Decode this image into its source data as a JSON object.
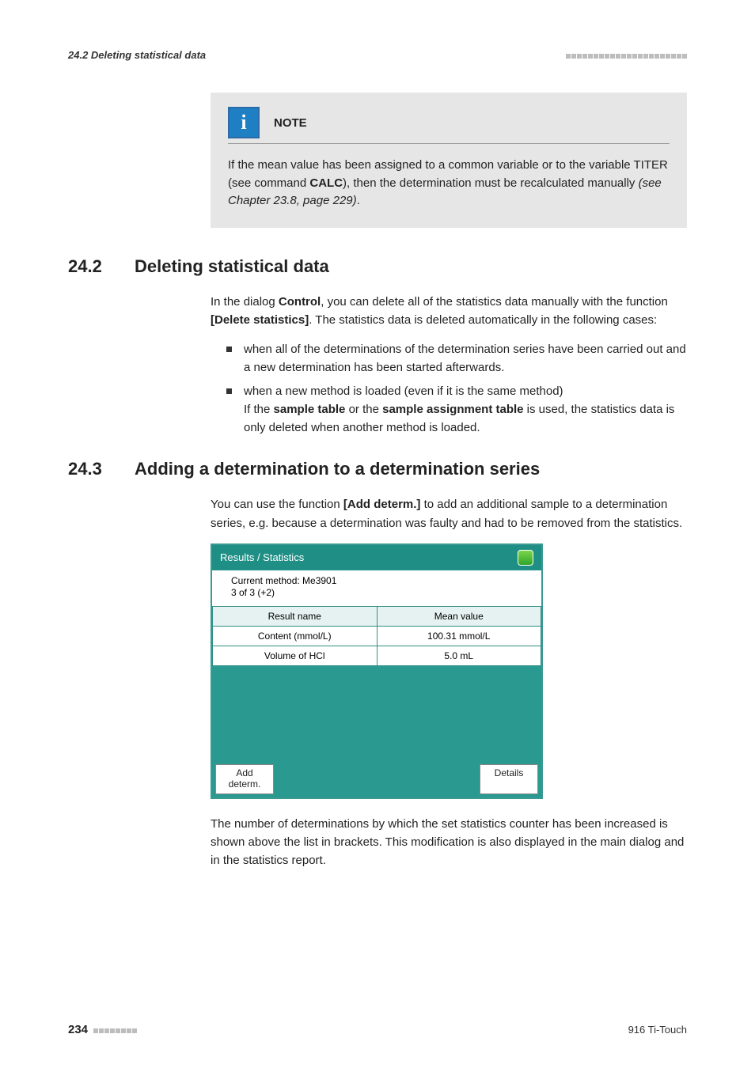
{
  "header": {
    "left": "24.2 Deleting statistical data"
  },
  "note": {
    "title": "NOTE",
    "body_1": "If the mean value has been assigned to a common variable or to the variable TITER (see command ",
    "body_calc": "CALC",
    "body_2": "), then the determination must be recalculated manually ",
    "body_ref": "(see Chapter 23.8, page 229)",
    "body_3": "."
  },
  "section_242": {
    "num": "24.2",
    "title": "Deleting statistical data",
    "p1_a": "In the dialog ",
    "p1_b1": "Control",
    "p1_b": ", you can delete all of the statistics data manually with the function ",
    "p1_b2": "[Delete statistics]",
    "p1_c": ". The statistics data is deleted automatically in the following cases:",
    "li1": "when all of the determinations of the determination series have been carried out and a new determination has been started afterwards.",
    "li2_a": "when a new method is loaded (even if it is the same method)",
    "li2_b1": "If the ",
    "li2_b2": "sample table",
    "li2_b3": " or the ",
    "li2_b4": "sample assignment table",
    "li2_b5": " is used, the statistics data is only deleted when another method is loaded."
  },
  "section_243": {
    "num": "24.3",
    "title": "Adding a determination to a determination series",
    "p1_a": "You can use the function ",
    "p1_b": "[Add determ.]",
    "p1_c": " to add an additional sample to a determination series, e.g. because a determination was faulty and had to be removed from the statistics.",
    "p2": "The number of determinations by which the set statistics counter has been increased is shown above the list in brackets. This modification is also displayed in the main dialog and in the statistics report."
  },
  "screenshot": {
    "title": "Results / Statistics",
    "method_line1": "Current method: Me3901",
    "method_line2": "3 of 3 (+2)",
    "col1": "Result name",
    "col2": "Mean value",
    "r1c1": "Content (mmol/L)",
    "r1c2": "100.31 mmol/L",
    "r2c1": "Volume of HCl",
    "r2c2": "5.0 mL",
    "btn_add": "Add\ndeterm.",
    "btn_details": "Details"
  },
  "footer": {
    "page": "234",
    "product": "916 Ti-Touch"
  }
}
